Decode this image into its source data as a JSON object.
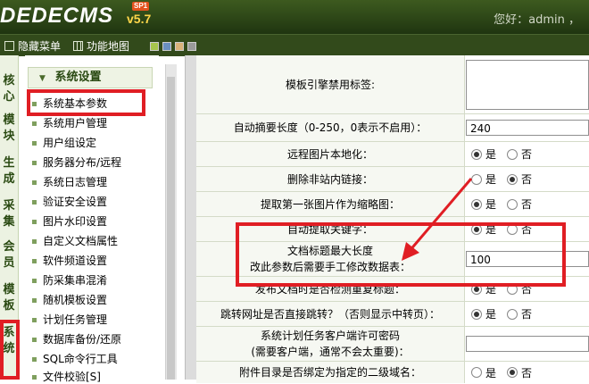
{
  "header": {
    "logo_text": "DEDECMS",
    "logo_version": "v5.7",
    "logo_sp": "SP1",
    "greeting": "您好：admin ，"
  },
  "toolbar": {
    "hide_menu": "隐藏菜单",
    "site_map": "功能地图",
    "skin_colors": [
      "#a7c64c",
      "#6a8fc0",
      "#d9b27a",
      "#9a9a9a"
    ]
  },
  "vtabs": [
    "核心",
    "模块",
    "生成",
    "采集",
    "会员",
    "模板",
    "系统"
  ],
  "sidebar": {
    "section_title": "系统设置",
    "items": [
      "系统基本参数",
      "系统用户管理",
      "用户组设定",
      "服务器分布/远程",
      "系统日志管理",
      "验证安全设置",
      "图片水印设置",
      "自定义文档属性",
      "软件频道设置",
      "防采集串混淆",
      "随机模板设置",
      "计划任务管理",
      "数据库备份/还原",
      "SQL命令行工具",
      "文件校验[S]"
    ]
  },
  "form": {
    "yes": "是",
    "no": "否",
    "rows": [
      {
        "label": "模板引擎禁用标签:",
        "type": "textarea",
        "value": ""
      },
      {
        "label": "自动摘要长度（0-250，0表示不启用）：",
        "type": "text",
        "value": "240"
      },
      {
        "label": "远程图片本地化：",
        "type": "radio",
        "selected": "yes"
      },
      {
        "label": "删除非站内链接：",
        "type": "radio",
        "selected": "no"
      },
      {
        "label": "提取第一张图片作为缩略图：",
        "type": "radio",
        "selected": "yes"
      },
      {
        "label": "自动提取关键字：",
        "type": "radio",
        "selected": "yes"
      },
      {
        "label": "文档标题最大长度",
        "label2": "改此参数后需要手工修改数据表：",
        "type": "text",
        "value": "100"
      },
      {
        "label": "发布文档时是否检测重复标题：",
        "type": "radio",
        "selected": "yes"
      },
      {
        "label": "跳转网址是否直接跳转？（否则显示中转页）：",
        "type": "radio",
        "selected": "yes"
      },
      {
        "label": "系统计划任务客户端许可密码",
        "label2": "(需要客户端，通常不会太重要)：",
        "type": "text",
        "value": ""
      },
      {
        "label": "附件目录是否绑定为指定的二级域名：",
        "type": "radio",
        "selected": "no"
      }
    ]
  },
  "annotation_color": "#e01e24"
}
